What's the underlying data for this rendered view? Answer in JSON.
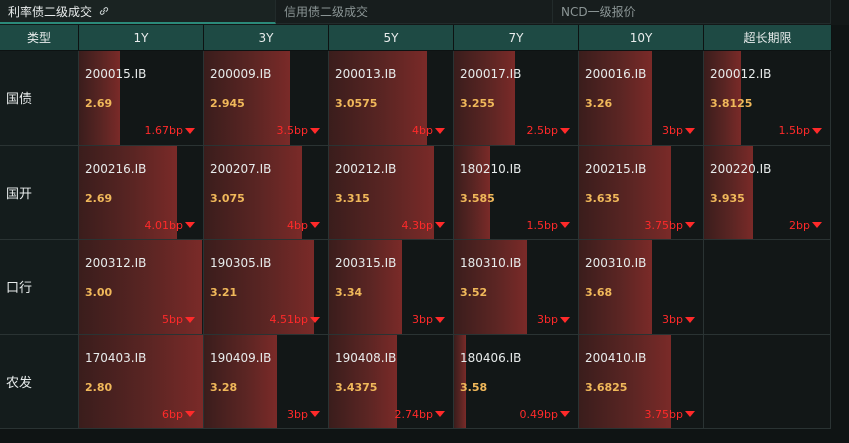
{
  "tabs": [
    {
      "label": "利率债二级成交",
      "active": true
    },
    {
      "label": "信用债二级成交",
      "active": false
    },
    {
      "label": "NCD一级报价",
      "active": false
    }
  ],
  "header": [
    "类型",
    "1Y",
    "3Y",
    "5Y",
    "7Y",
    "10Y",
    "超长期限"
  ],
  "rows": [
    {
      "type": "国债",
      "cells": [
        {
          "code": "200015.IB",
          "yield": "2.69",
          "change": "1.67bp",
          "fill": 0.33
        },
        {
          "code": "200009.IB",
          "yield": "2.945",
          "change": "3.5bp",
          "fill": 0.69
        },
        {
          "code": "200013.IB",
          "yield": "3.0575",
          "change": "4bp",
          "fill": 0.79
        },
        {
          "code": "200017.IB",
          "yield": "3.255",
          "change": "2.5bp",
          "fill": 0.49
        },
        {
          "code": "200016.IB",
          "yield": "3.26",
          "change": "3bp",
          "fill": 0.59
        },
        {
          "code": "200012.IB",
          "yield": "3.8125",
          "change": "1.5bp",
          "fill": 0.29
        }
      ]
    },
    {
      "type": "国开",
      "cells": [
        {
          "code": "200216.IB",
          "yield": "2.69",
          "change": "4.01bp",
          "fill": 0.79
        },
        {
          "code": "200207.IB",
          "yield": "3.075",
          "change": "4bp",
          "fill": 0.79
        },
        {
          "code": "200212.IB",
          "yield": "3.315",
          "change": "4.3bp",
          "fill": 0.85
        },
        {
          "code": "180210.IB",
          "yield": "3.585",
          "change": "1.5bp",
          "fill": 0.29
        },
        {
          "code": "200215.IB",
          "yield": "3.635",
          "change": "3.75bp",
          "fill": 0.74
        },
        {
          "code": "200220.IB",
          "yield": "3.935",
          "change": "2bp",
          "fill": 0.39
        }
      ]
    },
    {
      "type": "口行",
      "cells": [
        {
          "code": "200312.IB",
          "yield": "3.00",
          "change": "5bp",
          "fill": 0.99
        },
        {
          "code": "190305.IB",
          "yield": "3.21",
          "change": "4.51bp",
          "fill": 0.89
        },
        {
          "code": "200315.IB",
          "yield": "3.34",
          "change": "3bp",
          "fill": 0.59
        },
        {
          "code": "180310.IB",
          "yield": "3.52",
          "change": "3bp",
          "fill": 0.59
        },
        {
          "code": "200310.IB",
          "yield": "3.68",
          "change": "3bp",
          "fill": 0.59
        },
        null
      ]
    },
    {
      "type": "农发",
      "cells": [
        {
          "code": "170403.IB",
          "yield": "2.80",
          "change": "6bp",
          "fill": 1.0
        },
        {
          "code": "190409.IB",
          "yield": "3.28",
          "change": "3bp",
          "fill": 0.59
        },
        {
          "code": "190408.IB",
          "yield": "3.4375",
          "change": "2.74bp",
          "fill": 0.55
        },
        {
          "code": "180406.IB",
          "yield": "3.58",
          "change": "0.49bp",
          "fill": 0.1
        },
        {
          "code": "200410.IB",
          "yield": "3.6825",
          "change": "3.75bp",
          "fill": 0.74
        },
        null
      ]
    }
  ],
  "colors": {
    "header_bg": "#1e4a44",
    "yield": "#f0b85a",
    "change": "#ff2a2a"
  }
}
